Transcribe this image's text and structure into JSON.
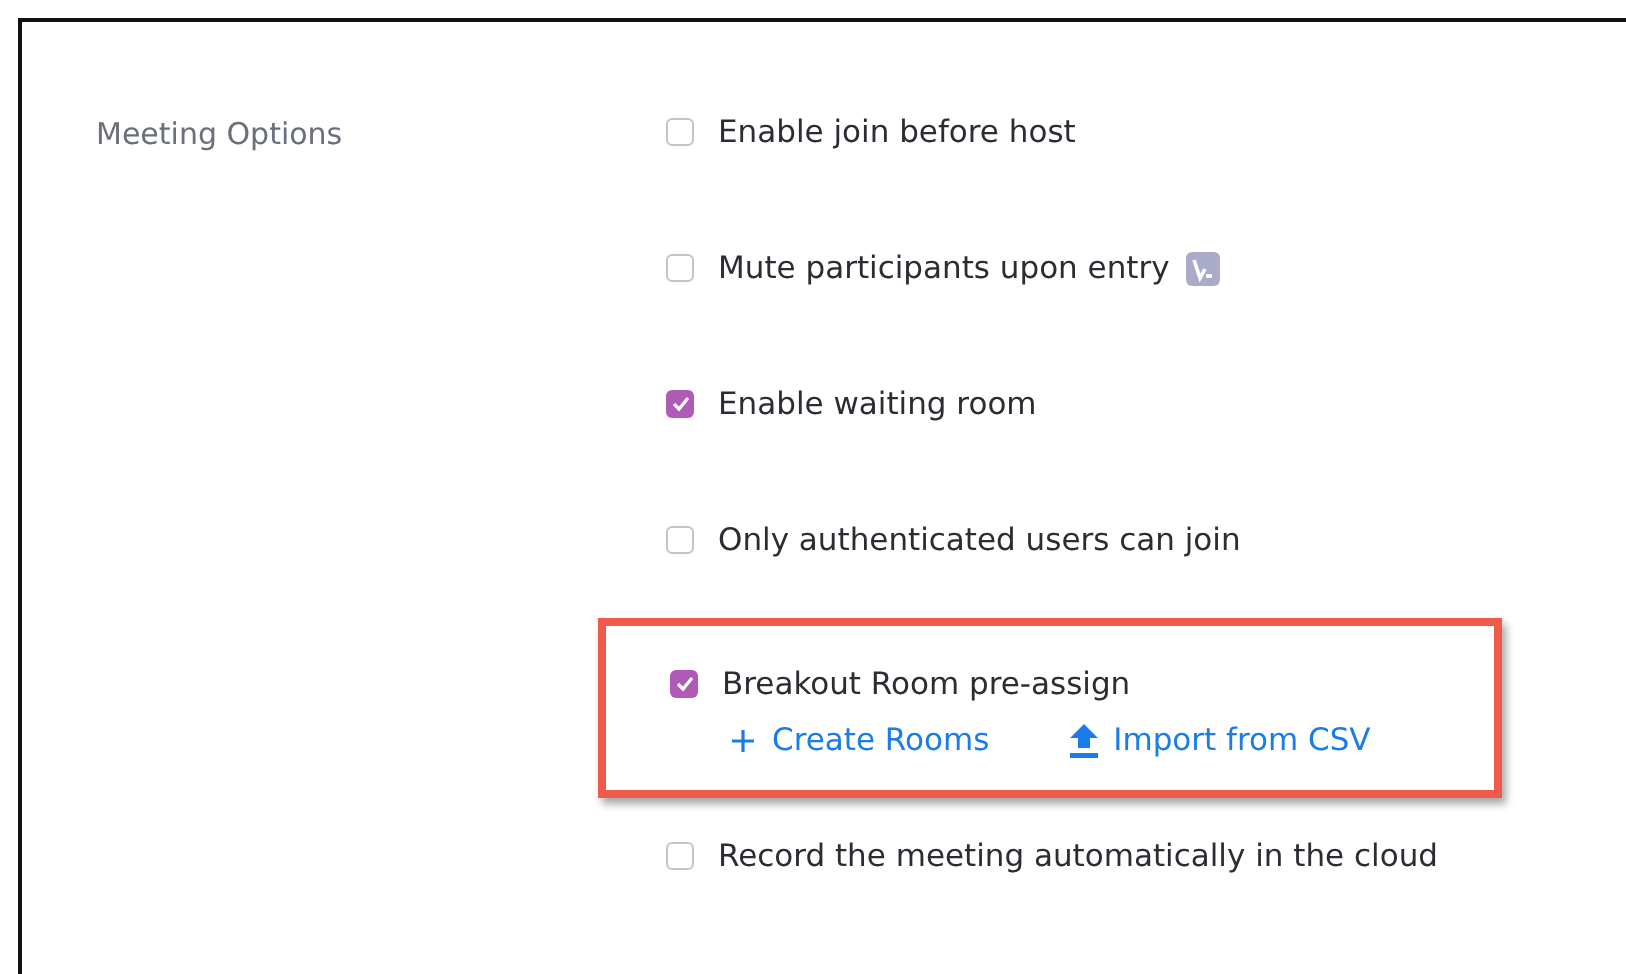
{
  "section_label": "Meeting Options",
  "options": [
    {
      "label": "Enable join before host",
      "checked": false,
      "highlighted": false,
      "badge": false
    },
    {
      "label": "Mute participants upon entry",
      "checked": false,
      "highlighted": false,
      "badge": true
    },
    {
      "label": "Enable waiting room",
      "checked": true,
      "highlighted": false,
      "badge": false
    },
    {
      "label": "Only authenticated users can join",
      "checked": false,
      "highlighted": false,
      "badge": false
    },
    {
      "label": "Breakout Room pre-assign",
      "checked": true,
      "highlighted": true,
      "badge": false,
      "links": [
        {
          "kind": "add",
          "label": "Create Rooms"
        },
        {
          "kind": "upload",
          "label": "Import from CSV"
        }
      ]
    },
    {
      "label": "Record the meeting automatically in the cloud",
      "checked": false,
      "highlighted": false,
      "badge": false
    }
  ]
}
